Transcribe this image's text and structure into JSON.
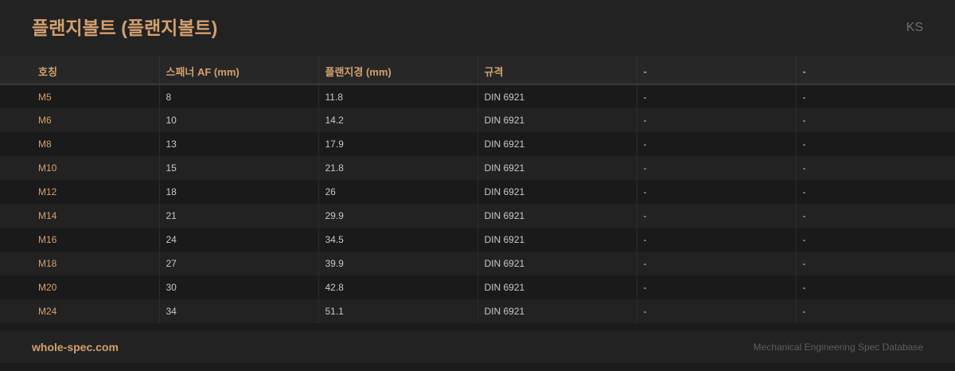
{
  "header": {
    "title": "플랜지볼트 (플랜지볼트)",
    "standard_badge": "KS"
  },
  "table": {
    "columns": [
      "호칭",
      "스패너 AF (mm)",
      "플랜지경 (mm)",
      "규격",
      "-",
      "-"
    ],
    "rows": [
      [
        "M5",
        "8",
        "11.8",
        "DIN 6921",
        "-",
        "-"
      ],
      [
        "M6",
        "10",
        "14.2",
        "DIN 6921",
        "-",
        "-"
      ],
      [
        "M8",
        "13",
        "17.9",
        "DIN 6921",
        "-",
        "-"
      ],
      [
        "M10",
        "15",
        "21.8",
        "DIN 6921",
        "-",
        "-"
      ],
      [
        "M12",
        "18",
        "26",
        "DIN 6921",
        "-",
        "-"
      ],
      [
        "M14",
        "21",
        "29.9",
        "DIN 6921",
        "-",
        "-"
      ],
      [
        "M16",
        "24",
        "34.5",
        "DIN 6921",
        "-",
        "-"
      ],
      [
        "M18",
        "27",
        "39.9",
        "DIN 6921",
        "-",
        "-"
      ],
      [
        "M20",
        "30",
        "42.8",
        "DIN 6921",
        "-",
        "-"
      ],
      [
        "M24",
        "34",
        "51.1",
        "DIN 6921",
        "-",
        "-"
      ]
    ]
  },
  "footer": {
    "brand": "whole-spec.com",
    "tagline": "Mechanical Engineering Spec Database"
  },
  "colors": {
    "accent": "#d3a06e",
    "background": "#1c1c1c",
    "row_alt": "#222222"
  }
}
